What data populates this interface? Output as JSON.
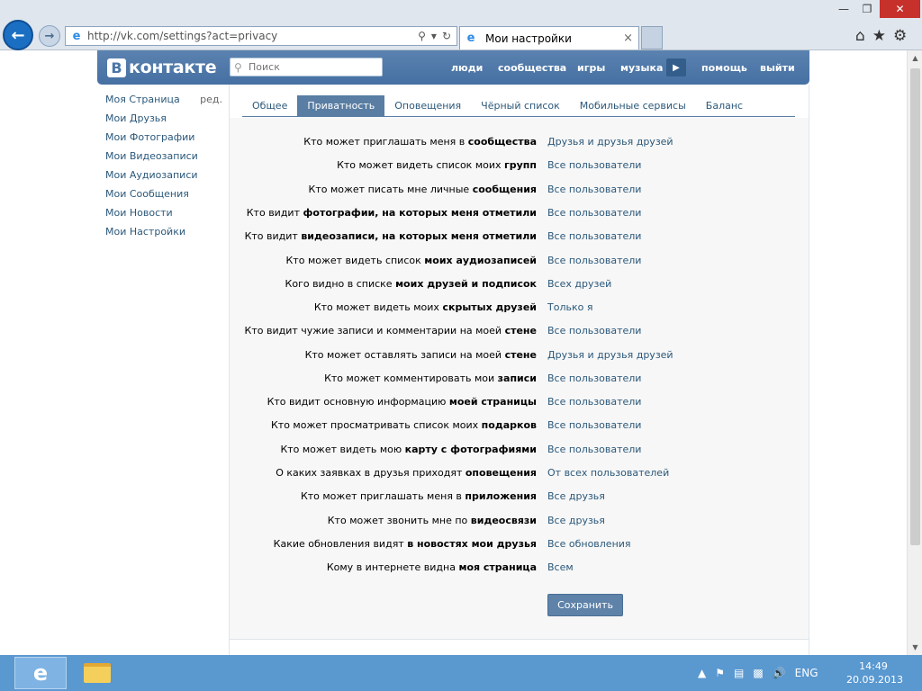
{
  "browser": {
    "address": "http://vk.com/settings?act=privacy",
    "tab_title": "Мои настройки",
    "window_controls": {
      "min": "—",
      "max": "❐",
      "close": "✕"
    }
  },
  "header": {
    "logo_letter": "В",
    "logo_text": "контакте",
    "search_placeholder": "Поиск",
    "nav": [
      "люди",
      "сообщества",
      "игры",
      "музыка",
      "помощь",
      "выйти"
    ]
  },
  "left_menu": {
    "items": [
      "Моя Страница",
      "Мои Друзья",
      "Мои Фотографии",
      "Мои Видеозаписи",
      "Мои Аудиозаписи",
      "Мои Сообщения",
      "Мои Новости",
      "Мои Настройки"
    ],
    "edit_label": "ред."
  },
  "tabs": [
    "Общее",
    "Приватность",
    "Оповещения",
    "Чёрный список",
    "Мобильные сервисы",
    "Баланс"
  ],
  "settings": [
    {
      "prefix": "Кто может приглашать меня в ",
      "bold": "сообщества",
      "value": "Друзья и друзья друзей"
    },
    {
      "prefix": "Кто может видеть список моих ",
      "bold": "групп",
      "value": "Все пользователи"
    },
    {
      "prefix": "Кто может писать мне личные ",
      "bold": "сообщения",
      "value": "Все пользователи"
    },
    {
      "prefix": "Кто видит ",
      "bold": "фотографии, на которых меня отметили",
      "value": "Все пользователи"
    },
    {
      "prefix": "Кто видит ",
      "bold": "видеозаписи, на которых меня отметили",
      "value": "Все пользователи"
    },
    {
      "prefix": "Кто может видеть список ",
      "bold": "моих аудиозаписей",
      "value": "Все пользователи"
    },
    {
      "prefix": "Кого видно в списке ",
      "bold": "моих друзей и подписок",
      "value": "Всех друзей"
    },
    {
      "prefix": "Кто может видеть моих ",
      "bold": "скрытых друзей",
      "value": "Только я"
    },
    {
      "prefix": "Кто видит чужие записи и комментарии на моей ",
      "bold": "стене",
      "value": "Все пользователи"
    },
    {
      "prefix": "Кто может оставлять записи на моей ",
      "bold": "стене",
      "value": "Друзья и друзья друзей"
    },
    {
      "prefix": "Кто может комментировать мои ",
      "bold": "записи",
      "value": "Все пользователи"
    },
    {
      "prefix": "Кто видит основную информацию ",
      "bold": "моей страницы",
      "value": "Все пользователи"
    },
    {
      "prefix": "Кто может просматривать список моих ",
      "bold": "подарков",
      "value": "Все пользователи"
    },
    {
      "prefix": "Кто может видеть мою ",
      "bold": "карту с фотографиями",
      "value": "Все пользователи"
    },
    {
      "prefix": "О каких заявках в друзья приходят ",
      "bold": "оповещения",
      "value": "От всех пользователей"
    },
    {
      "prefix": "Кто может приглашать меня в ",
      "bold": "приложения",
      "value": "Все друзья"
    },
    {
      "prefix": "Кто может звонить мне по ",
      "bold": "видеосвязи",
      "value": "Все друзья"
    },
    {
      "prefix": "Какие обновления видят ",
      "bold": "в новостях мои друзья",
      "value": "Все обновления"
    },
    {
      "prefix": "Кому в интернете видна ",
      "bold": "моя страница",
      "value": "Всем"
    }
  ],
  "save_label": "Сохранить",
  "taskbar": {
    "lang": "ENG",
    "time": "14:49",
    "date": "20.09.2013"
  },
  "colors": {
    "vk_blue": "#4a76a8",
    "link": "#2b587a",
    "tab_active": "#597da3",
    "taskbar": "#5a98d0",
    "close_red": "#c7312b"
  }
}
